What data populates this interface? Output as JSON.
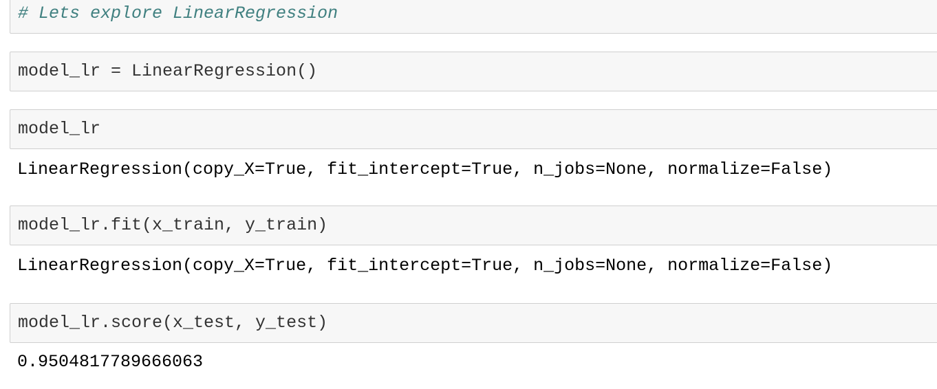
{
  "cells": [
    {
      "input": "# Lets explore LinearRegression",
      "output": null
    },
    {
      "input": "model_lr = LinearRegression()",
      "output": null
    },
    {
      "input": "model_lr",
      "output": "LinearRegression(copy_X=True, fit_intercept=True, n_jobs=None, normalize=False)"
    },
    {
      "input": "model_lr.fit(x_train, y_train)",
      "output": "LinearRegression(copy_X=True, fit_intercept=True, n_jobs=None, normalize=False)"
    },
    {
      "input": "model_lr.score(x_test, y_test)",
      "output": "0.9504817789666063"
    }
  ],
  "colors": {
    "cell_background": "#f7f7f7",
    "cell_border": "#cfcfcf",
    "code_text": "#333333",
    "comment_text": "#408080",
    "output_text": "#000000"
  }
}
